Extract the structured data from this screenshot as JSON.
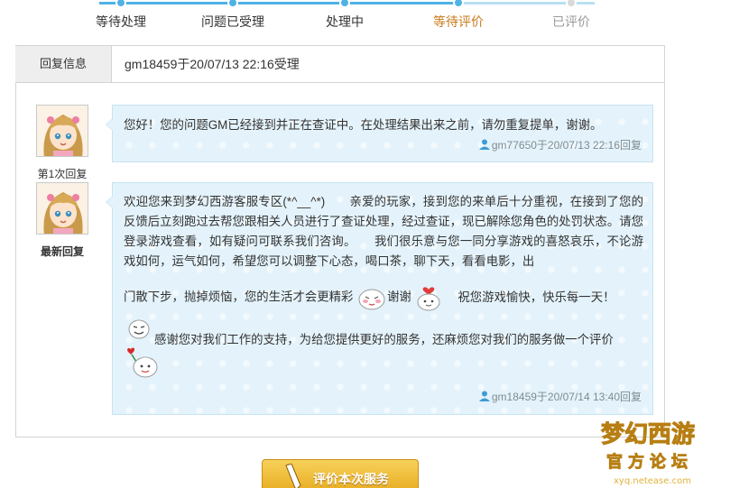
{
  "progress": {
    "steps": [
      {
        "label": "等待处理",
        "state": "done"
      },
      {
        "label": "问题已受理",
        "state": "done"
      },
      {
        "label": "处理中",
        "state": "done"
      },
      {
        "label": "等待评价",
        "state": "current"
      },
      {
        "label": "已评价",
        "state": "pending"
      }
    ]
  },
  "reply_info": {
    "label": "回复信息",
    "value": "gm18459于20/07/13 22:16受理"
  },
  "replies": [
    {
      "caption": "第1次回复",
      "text": "您好！您的问题GM已经接到并正在查证中。在处理结果出来之前，请勿重复提单，谢谢。",
      "meta": "gm77650于20/07/13 22:16回复"
    },
    {
      "caption": "最新回复",
      "paragraph": "欢迎您来到梦幻西游客服专区(*^__^*)　　亲爱的玩家，接到您的来单后十分重视，在接到了您的反馈后立刻跑过去帮您跟相关人员进行了查证处理，经过查证，现已解除您角色的处罚状态。请您登录游戏查看，如有疑问可联系我们咨询。　　我们很乐意与您一同分享游戏的喜怒哀乐，不论游戏如何，运气如何，希望您可以调整下心态，喝口茶，聊下天，看看电影，出",
      "line2_a": "门散下步，抛掉烦恼，您的生活才会更精彩",
      "line2_b": "谢谢",
      "line2_c": "祝您游戏愉快，快乐每一天！",
      "line3": "感谢您对我们工作的支持，为给您提供更好的服务，还麻烦您对我们的服务做一个评价",
      "meta": "gm18459于20/07/14 13:40回复"
    }
  ],
  "rate_button": {
    "label": "评价本次服务"
  },
  "watermark": {
    "line1": "梦幻西游",
    "line2": "官方论坛",
    "line3": "xyq.netease.com"
  },
  "colors": {
    "accent_blue": "#4fb2e6",
    "current_step": "#c77a1a",
    "bubble_bg": "#e4f3fb",
    "button_gold": "#e7a91d"
  }
}
